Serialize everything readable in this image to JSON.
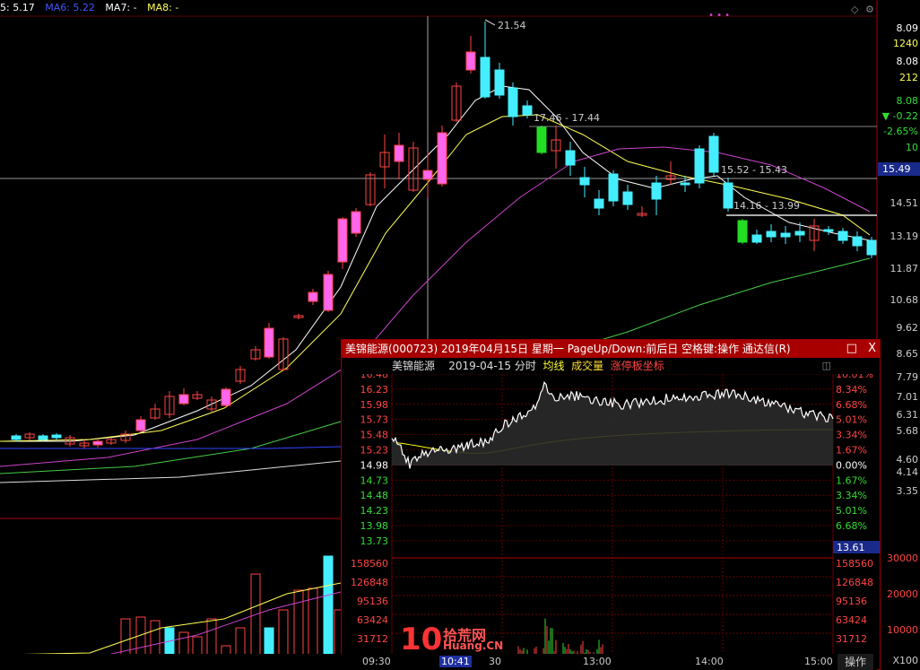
{
  "main_chart": {
    "ma_legend": [
      {
        "label": "5: 5.17",
        "color": "#ffffff"
      },
      {
        "label": "MA6: 5.22",
        "color": "#4444ff"
      },
      {
        "label": "MA7: -",
        "color": "#ffffff"
      },
      {
        "label": "MA8: -",
        "color": "#ffff55"
      }
    ],
    "high_label": "21.54",
    "annotations": [
      "17.46 - 17.44",
      "15.52 - 15.43",
      "14.16 - 13.99"
    ],
    "crosshair_price": "15.49",
    "right_axis": [
      "8.09",
      "1240",
      "8.08",
      "212",
      "8.08",
      "-0.22",
      "-2.65%",
      "10",
      "14.51",
      "13.19",
      "11.87",
      "10.68",
      "9.62",
      "8.65",
      "7.79",
      "7.01",
      "6.31",
      "5.68",
      "4.60",
      "4.14",
      "3.35"
    ],
    "volume_axis": [
      "30000",
      "20000",
      "10000",
      "X100"
    ]
  },
  "popup": {
    "title": "美锦能源(000723) 2019年04月15日 星期一 PageUp/Down:前后日 空格键:操作 通达信(R)",
    "buttons": {
      "maximize": "□",
      "close": "X"
    },
    "header": {
      "name": "美锦能源",
      "date": "2019-04-15 分时",
      "avg_line": "均线",
      "volume": "成交量",
      "limit_axis": "涨停板坐标"
    },
    "price_axis_left": [
      "16.48",
      "16.23",
      "15.98",
      "15.73",
      "15.48",
      "15.23",
      "14.98",
      "14.73",
      "14.48",
      "14.23",
      "13.98",
      "13.73"
    ],
    "pct_axis_right": [
      "10.01%",
      "8.34%",
      "6.68%",
      "5.01%",
      "3.34%",
      "1.67%",
      "0.00%",
      "1.67%",
      "3.34%",
      "5.01%",
      "6.68%"
    ],
    "current_price": "13.61",
    "volume_axis": [
      "158560",
      "126848",
      "95136",
      "63424",
      "31712"
    ],
    "volume_axis_right": [
      "158560",
      "126848",
      "95136",
      "63424",
      "31712"
    ],
    "time_axis": [
      "09:30",
      "10:41",
      "30",
      "13:00",
      "14:00",
      "15:00"
    ],
    "operate_button": "操作",
    "colors": {
      "up": "#ff3333",
      "down": "#33dd33",
      "flat": "#ffffff",
      "price_line": "#ffffff",
      "avg_line": "#ffff00"
    }
  },
  "watermark": {
    "text1": "拾荒网",
    "text2": "Huang.CN"
  }
}
